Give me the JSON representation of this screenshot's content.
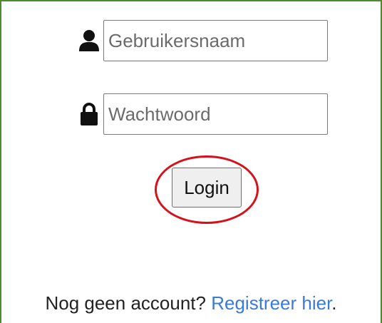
{
  "form": {
    "username": {
      "placeholder": "Gebruikersnaam",
      "value": ""
    },
    "password": {
      "placeholder": "Wachtwoord",
      "value": ""
    },
    "login_label": "Login"
  },
  "footer": {
    "prompt": "Nog geen account?",
    "register_link": "Registreer hier",
    "trailing": "."
  },
  "icons": {
    "username": "user-icon",
    "password": "lock-icon"
  },
  "colors": {
    "highlight_ring": "#d5121c",
    "link": "#3a7bd5",
    "frame_border": "#4f8a2f"
  }
}
